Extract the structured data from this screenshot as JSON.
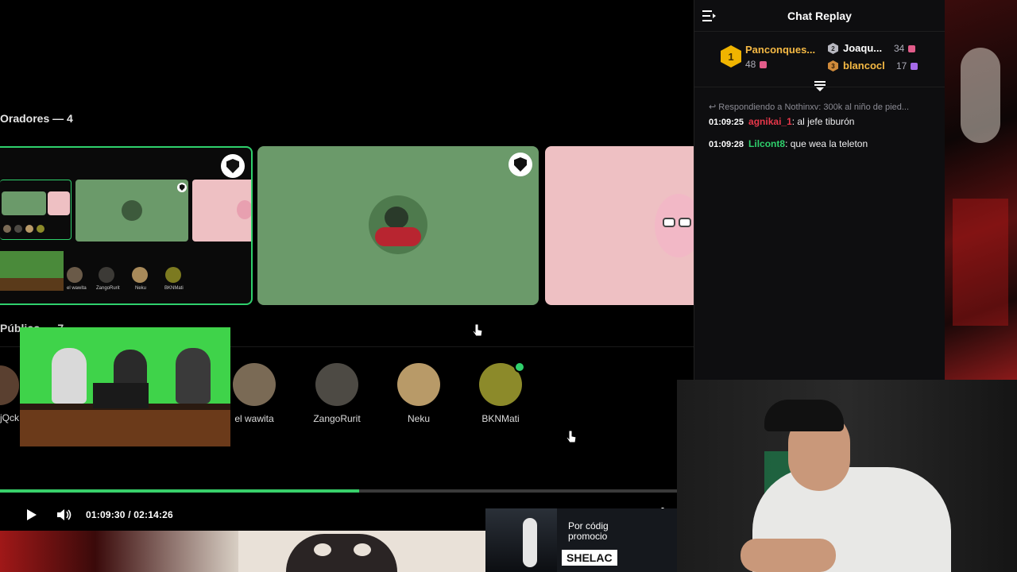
{
  "stage": {
    "speakers_title": "Oradores — 4",
    "public_title": "Público — 7"
  },
  "nested_tile": {
    "mini_labels": [
      "el wawita",
      "ZangoRurit",
      "Neku",
      "BKNMati"
    ]
  },
  "public_users": [
    {
      "name": "el wawita",
      "color": "#7a6a55",
      "live": false
    },
    {
      "name": "ZangoRurit",
      "color": "#4d4a44",
      "live": false
    },
    {
      "name": "Neku",
      "color": "#b89a68",
      "live": false
    },
    {
      "name": "BKNMati",
      "color": "#8c8a2a",
      "live": true
    }
  ],
  "public_cut_label": "jQck",
  "player": {
    "current_time": "01:09:30",
    "separator": "/",
    "total_time": "02:14:26",
    "progress_fraction": 0.53,
    "accent_color": "#38d06a"
  },
  "chat": {
    "title": "Chat Replay",
    "leaderboard": {
      "first": {
        "rank": "1",
        "name": "Panconques...",
        "count": "48"
      },
      "second": {
        "rank": "2",
        "name": "Joaqu...",
        "count": "34"
      },
      "third": {
        "rank": "3",
        "name": "blancocl",
        "count": "17"
      }
    },
    "reply_context": "Respondiendo a Nothinxv: 300k al niño de pied...",
    "messages": [
      {
        "time": "01:09:25",
        "user": "agnikai_1",
        "user_color": "#e8374a",
        "text": "al jefe tiburón"
      },
      {
        "time": "01:09:28",
        "user": "Lilcont8",
        "user_color": "#2fd06c",
        "text": "que wea la teleton"
      }
    ]
  },
  "promo": {
    "line1": "Por códig",
    "line2": "promocio",
    "code": "SHELAC"
  },
  "icons": {
    "collapse": "collapse-chat-icon",
    "play": "play-icon",
    "volume": "volume-icon",
    "speed": "playback-speed-icon",
    "settings": "gear-icon",
    "moderator": "moderator-shield-icon",
    "scroll": "scroll-to-bottom-icon"
  }
}
